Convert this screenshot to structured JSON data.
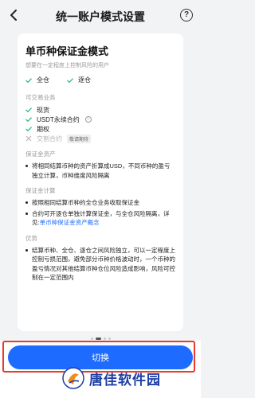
{
  "header": {
    "title": "统一账户模式设置",
    "help_glyph": "?"
  },
  "card": {
    "title": "单币种保证金模式",
    "subtitle": "想要在一定程度上控制风险的用户",
    "modes": [
      {
        "label": "全仓"
      },
      {
        "label": "逐仓"
      }
    ],
    "business": {
      "label": "可交易业务",
      "items": [
        {
          "label": "现货",
          "enabled": true
        },
        {
          "label": "USDT永续合约",
          "enabled": true,
          "info": "i"
        },
        {
          "label": "期权",
          "enabled": true
        },
        {
          "label": "交割合约",
          "enabled": false,
          "badge": "敬请期待"
        }
      ]
    },
    "assets": {
      "label": "保证金资产",
      "bullets": [
        "将相同结算币种的资产折算成USD，不同币种的盈亏独立计算，币种维度风险隔离"
      ]
    },
    "calc": {
      "label": "保证金计算",
      "bullet1": "按照相同结算币种的全仓业务收取保证金",
      "bullet2_text": "合约可开逐仓单独计算保证金，与全仓风险隔离，详见:",
      "bullet2_link": "单币种保证金资产概念"
    },
    "advantage": {
      "label": "优势",
      "bullets": [
        "结算币种、全仓、逐仓之间风险独立，可以一定程度上控制亏损范围，避免部分币种价格波动时，一个币种的盈亏情况对其他结算币种仓位风险造成影响，风险可控制在一定范围内"
      ]
    }
  },
  "footer": {
    "switch_label": "切换"
  },
  "watermark": {
    "text": "唐佳软件园"
  },
  "colors": {
    "accent": "#1d6bff",
    "check": "#2db87d",
    "highlight": "#e83a2e"
  }
}
